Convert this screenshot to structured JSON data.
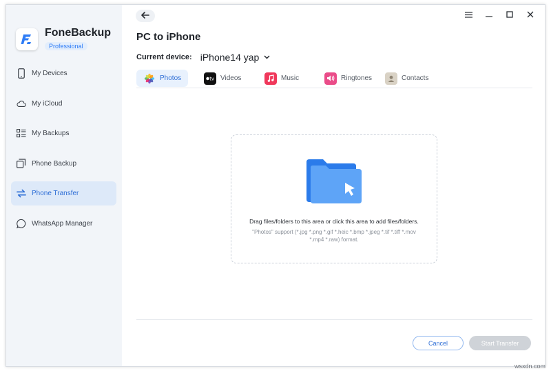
{
  "app": {
    "name": "FoneBackup",
    "edition": "Professional",
    "accent_color": "#2f7df6"
  },
  "sidebar": {
    "items": [
      {
        "label": "My Devices",
        "icon": "phone-icon"
      },
      {
        "label": "My iCloud",
        "icon": "cloud-icon"
      },
      {
        "label": "My Backups",
        "icon": "backups-list-icon"
      },
      {
        "label": "Phone Backup",
        "icon": "copy-icon"
      },
      {
        "label": "Phone Transfer",
        "icon": "transfer-arrows-icon",
        "active": true
      },
      {
        "label": "WhatsApp Manager",
        "icon": "chat-bubble-icon"
      }
    ]
  },
  "header": {
    "back_icon": "back-arrow-icon",
    "window_controls": [
      "menu-icon",
      "minimize-icon",
      "maximize-icon",
      "close-icon"
    ]
  },
  "page": {
    "title": "PC to iPhone",
    "device_label": "Current device:",
    "device_name": "iPhone14 yap"
  },
  "tabs": [
    {
      "label": "Photos",
      "icon": "photos-icon",
      "active": true
    },
    {
      "label": "Videos",
      "icon": "appletv-icon"
    },
    {
      "label": "Music",
      "icon": "music-icon"
    },
    {
      "label": "Ringtones",
      "icon": "ringtone-icon"
    },
    {
      "label": "Contacts",
      "icon": "contacts-icon"
    }
  ],
  "dropzone": {
    "primary_text": "Drag files/folders to this area or click this area to add files/folders.",
    "secondary_text": "\"Photos\" support (*.jpg *.png *.gif *.heic *.bmp *.jpeg *.tif *.tiff *.mov *.mp4 *.raw) format."
  },
  "footer": {
    "cancel_label": "Cancel",
    "start_label": "Start Transfer"
  },
  "watermark": "wsxdn.com"
}
